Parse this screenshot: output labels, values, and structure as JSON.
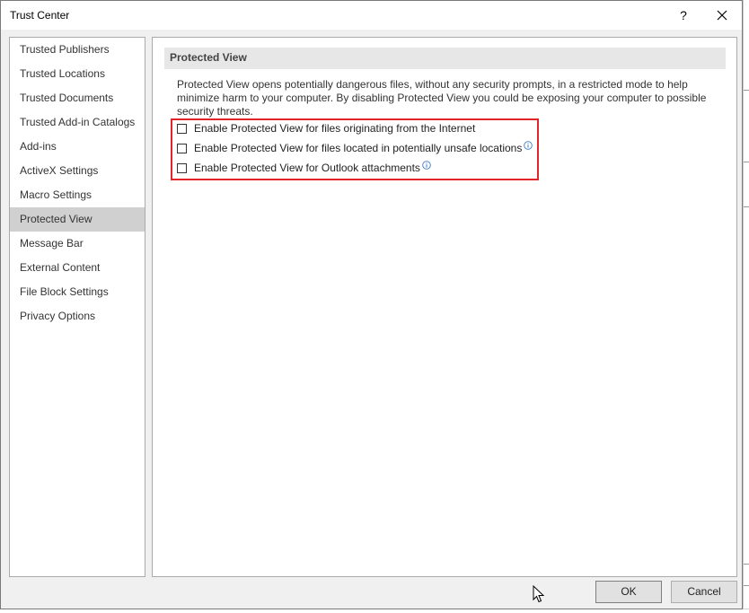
{
  "window": {
    "title": "Trust Center",
    "help_label": "?"
  },
  "sidebar": {
    "items": [
      {
        "label": "Trusted Publishers"
      },
      {
        "label": "Trusted Locations"
      },
      {
        "label": "Trusted Documents"
      },
      {
        "label": "Trusted Add-in Catalogs"
      },
      {
        "label": "Add-ins"
      },
      {
        "label": "ActiveX Settings"
      },
      {
        "label": "Macro Settings"
      },
      {
        "label": "Protected View",
        "selected": true
      },
      {
        "label": "Message Bar"
      },
      {
        "label": "External Content"
      },
      {
        "label": "File Block Settings"
      },
      {
        "label": "Privacy Options"
      }
    ]
  },
  "main": {
    "section_title": "Protected View",
    "description": "Protected View opens potentially dangerous files, without any security prompts, in a restricted mode to help minimize harm to your computer. By disabling Protected View you could be exposing your computer to possible security threats.",
    "options": [
      {
        "label": "Enable Protected View for files originating from the Internet",
        "checked": false,
        "info": false
      },
      {
        "label": "Enable Protected View for files located in potentially unsafe locations",
        "checked": false,
        "info": true
      },
      {
        "label": "Enable Protected View for Outlook attachments",
        "checked": false,
        "info": true
      }
    ]
  },
  "footer": {
    "ok_label": "OK",
    "cancel_label": "Cancel"
  },
  "colors": {
    "highlight": "#e0262b",
    "selected_item": "#d0d0d0",
    "info_icon": "#3b79c6"
  }
}
